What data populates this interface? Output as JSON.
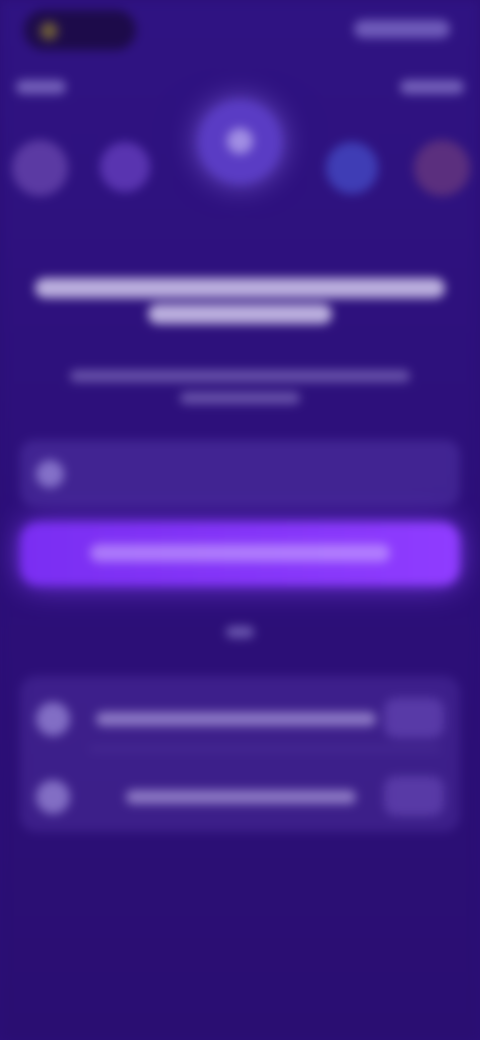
{
  "theme": {
    "background": "#2c0f78",
    "accent": "#8a3cff"
  },
  "icons": {
    "status": "status-icons",
    "avatar": "avatar-icon",
    "input": "input-icon",
    "list_item": "list-item-icon"
  },
  "note": ""
}
